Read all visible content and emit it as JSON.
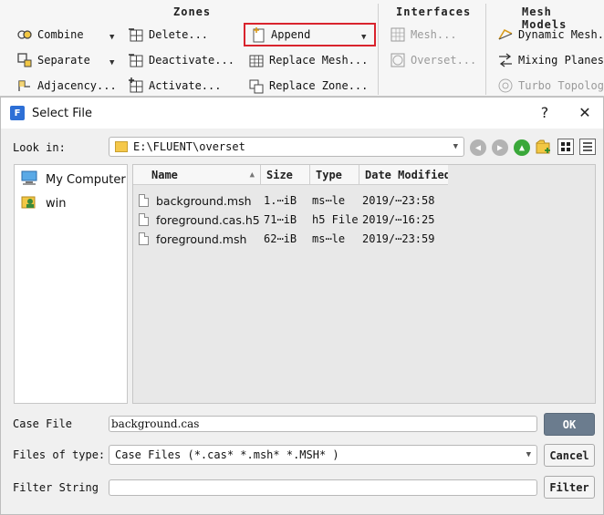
{
  "ribbon": {
    "zones": {
      "title": "Zones",
      "combine": "Combine",
      "separate": "Separate",
      "adjacency": "Adjacency...",
      "delete": "Delete...",
      "deactivate": "Deactivate...",
      "activate": "Activate...",
      "append": "Append",
      "replace_mesh": "Replace Mesh...",
      "replace_zone": "Replace Zone..."
    },
    "interfaces": {
      "title": "Interfaces",
      "mesh": "Mesh...",
      "overset": "Overset..."
    },
    "mesh_models": {
      "title": "Mesh Models",
      "dynamic_mesh": "Dynamic Mesh...",
      "mixing_planes": "Mixing Planes...",
      "turbo_topology": "Turbo Topology..."
    },
    "highlight_color": "#d9232d"
  },
  "dialog": {
    "title": "Select File",
    "app_icon_letter": "F",
    "help": "?",
    "close": "✕",
    "look_in_label": "Look in:",
    "look_in_path": "E:\\FLUENT\\overset",
    "places": [
      {
        "label": "My Computer",
        "icon": "computer-icon"
      },
      {
        "label": "win",
        "icon": "user-folder-icon"
      }
    ],
    "columns": [
      "Name",
      "Size",
      "Type",
      "Date Modified"
    ],
    "files": [
      {
        "name": "background.msh",
        "size": "1.⋯iB",
        "type": "ms⋯le",
        "date": "2019/⋯23:58"
      },
      {
        "name": "foreground.cas.h5",
        "size": "71⋯iB",
        "type": "h5 File",
        "date": "2019/⋯16:25"
      },
      {
        "name": "foreground.msh",
        "size": "62⋯iB",
        "type": "ms⋯le",
        "date": "2019/⋯23:59"
      }
    ],
    "case_file_label": "Case File",
    "case_file_value": "background.cas",
    "ok": "OK",
    "files_of_type_label": "Files of type:",
    "files_of_type_value": "Case Files (*.cas* *.msh* *.MSH* )",
    "cancel": "Cancel",
    "filter_string_label": "Filter String",
    "filter_string_value": "",
    "filter": "Filter"
  }
}
